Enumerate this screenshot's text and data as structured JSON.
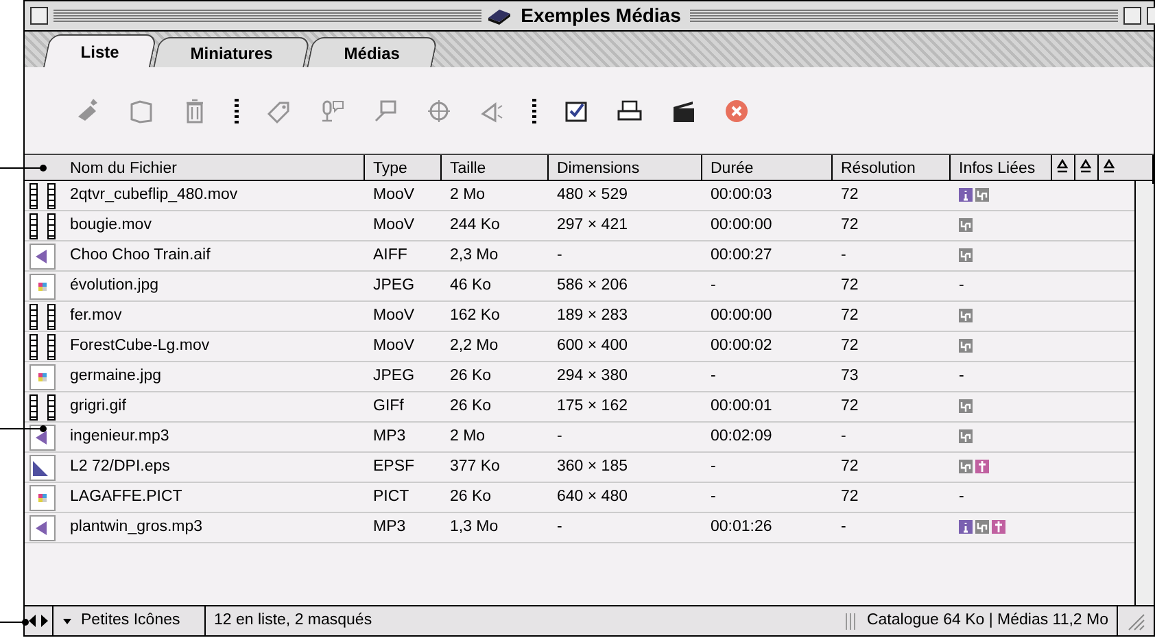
{
  "window": {
    "title": "Exemples Médias"
  },
  "tabs": [
    {
      "label": "Liste",
      "selected": true
    },
    {
      "label": "Miniatures",
      "selected": false
    },
    {
      "label": "Médias",
      "selected": false
    }
  ],
  "toolbar": [
    {
      "kind": "tool",
      "disabled": true
    },
    {
      "kind": "tool",
      "disabled": true
    },
    {
      "kind": "tool",
      "disabled": true
    },
    {
      "kind": "separator"
    },
    {
      "kind": "tool",
      "disabled": true
    },
    {
      "kind": "tool",
      "disabled": true
    },
    {
      "kind": "tool",
      "disabled": true
    },
    {
      "kind": "tool",
      "disabled": true
    },
    {
      "kind": "tool",
      "disabled": true
    },
    {
      "kind": "separator"
    },
    {
      "kind": "tool",
      "disabled": false
    },
    {
      "kind": "tool",
      "disabled": false
    },
    {
      "kind": "tool",
      "disabled": false
    },
    {
      "kind": "tool",
      "disabled": false
    }
  ],
  "table": {
    "columns": [
      "Nom du Fichier",
      "Type",
      "Taille",
      "Dimensions",
      "Durée",
      "Résolution",
      "Infos Liées"
    ],
    "rows": [
      {
        "kind": "movie",
        "name": "2qtvr_cubeflip_480.mov",
        "type": "MooV",
        "size": "2 Mo",
        "dimensions": "480 × 529",
        "duration": "00:00:03",
        "resolution": "72",
        "infos": [
          {
            "kind": "info"
          },
          {
            "kind": "link"
          }
        ]
      },
      {
        "kind": "movie",
        "name": "bougie.mov",
        "type": "MooV",
        "size": "244 Ko",
        "dimensions": "297 × 421",
        "duration": "00:00:00",
        "resolution": "72",
        "infos": [
          {
            "kind": "link"
          }
        ]
      },
      {
        "kind": "sound",
        "name": "Choo Choo Train.aif",
        "type": "AIFF",
        "size": "2,3 Mo",
        "dimensions": "-",
        "duration": "00:00:27",
        "resolution": "-",
        "infos": [
          {
            "kind": "link"
          }
        ]
      },
      {
        "kind": "image",
        "name": "évolution.jpg",
        "type": "JPEG",
        "size": "46 Ko",
        "dimensions": "586 × 206",
        "duration": "-",
        "resolution": "72",
        "infos": "-"
      },
      {
        "kind": "movie",
        "name": "fer.mov",
        "type": "MooV",
        "size": "162 Ko",
        "dimensions": "189 × 283",
        "duration": "00:00:00",
        "resolution": "72",
        "infos": [
          {
            "kind": "link"
          }
        ]
      },
      {
        "kind": "movie",
        "name": "ForestCube-Lg.mov",
        "type": "MooV",
        "size": "2,2 Mo",
        "dimensions": "600 × 400",
        "duration": "00:00:02",
        "resolution": "72",
        "infos": [
          {
            "kind": "link"
          }
        ]
      },
      {
        "kind": "image",
        "name": "germaine.jpg",
        "type": "JPEG",
        "size": "26 Ko",
        "dimensions": "294 × 380",
        "duration": "-",
        "resolution": "73",
        "infos": "-"
      },
      {
        "kind": "movie",
        "name": "grigri.gif",
        "type": "GIFf",
        "size": "26 Ko",
        "dimensions": "175 × 162",
        "duration": "00:00:01",
        "resolution": "72",
        "infos": [
          {
            "kind": "link"
          }
        ]
      },
      {
        "kind": "sound",
        "name": "ingenieur.mp3",
        "type": "MP3",
        "size": "2 Mo",
        "dimensions": "-",
        "duration": "00:02:09",
        "resolution": "-",
        "infos": [
          {
            "kind": "link"
          }
        ]
      },
      {
        "kind": "vector",
        "name": "L2 72/DPI.eps",
        "type": "EPSF",
        "size": "377 Ko",
        "dimensions": "360 × 185",
        "duration": "-",
        "resolution": "72",
        "infos": [
          {
            "kind": "link"
          },
          {
            "kind": "cross"
          }
        ]
      },
      {
        "kind": "image",
        "name": "LAGAFFE.PICT",
        "type": "PICT",
        "size": "26 Ko",
        "dimensions": "640 × 480",
        "duration": "-",
        "resolution": "72",
        "infos": "-"
      },
      {
        "kind": "sound",
        "name": "plantwin_gros.mp3",
        "type": "MP3",
        "size": "1,3 Mo",
        "dimensions": "-",
        "duration": "00:01:26",
        "resolution": "-",
        "infos": [
          {
            "kind": "info"
          },
          {
            "kind": "link"
          },
          {
            "kind": "cross"
          }
        ]
      }
    ]
  },
  "status_bar": {
    "view": "Petites Icônes",
    "count": "12 en liste, 2 masqués",
    "sizes": "Catalogue 64 Ko | Médias 11,2 Mo"
  }
}
